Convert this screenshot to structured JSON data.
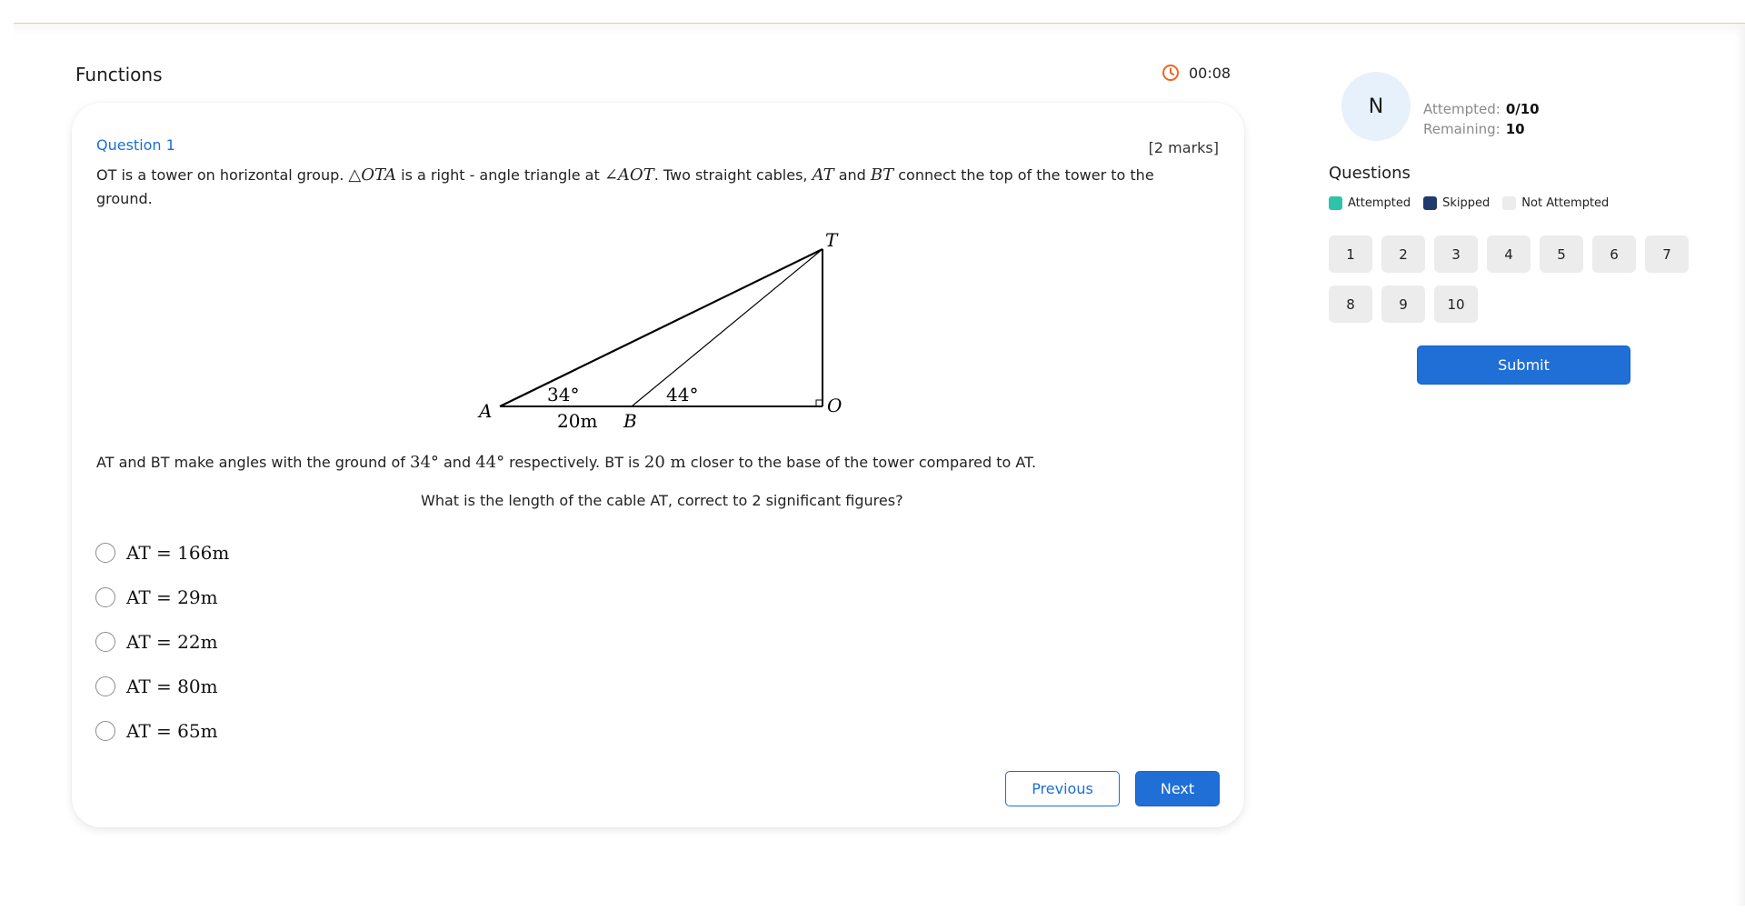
{
  "quiz": {
    "title": "Functions",
    "timer": "00:08"
  },
  "question": {
    "number_label": "Question 1",
    "marks": "[2 marks]",
    "stem": {
      "p1": "OT is a tower on horizontal group. ",
      "m1": "△OTA",
      "p2": " is a right - angle triangle at ",
      "m2": "∠AOT",
      "p3": ". Two straight cables, ",
      "m3": "AT",
      "p4": " and ",
      "m4": "BT",
      "p5": " connect the top of the tower to the ground."
    },
    "diagram": {
      "labels": {
        "A": "A",
        "B": "B",
        "T": "T",
        "O": "O",
        "angle_A": "34°",
        "angle_B": "44°",
        "distance_AB": "20m"
      }
    },
    "info": {
      "p1": "AT and BT make angles with the ground of ",
      "m1": "34°",
      "p2": " and ",
      "m2": "44°",
      "p3": " respectively. BT is ",
      "m3": "20 m",
      "p4": " closer to the base of the tower compared to AT."
    },
    "prompt": "What is the length of the cable AT, correct to 2 significant figures?",
    "options": [
      "AT = 166m",
      "AT = 29m",
      "AT = 22m",
      "AT = 80m",
      "AT = 65m"
    ]
  },
  "nav": {
    "previous_label": "Previous",
    "next_label": "Next"
  },
  "sidebar": {
    "avatar_initial": "N",
    "attempted_label": "Attempted:",
    "attempted_value": "0/10",
    "remaining_label": "Remaining:",
    "remaining_value": "10",
    "questions_title": "Questions",
    "legend": [
      {
        "label": "Attempted",
        "color": "#2ec4a9"
      },
      {
        "label": "Skipped",
        "color": "#1f3a6e"
      },
      {
        "label": "Not Attempted",
        "color": "#ececec"
      }
    ],
    "question_numbers": [
      "1",
      "2",
      "3",
      "4",
      "5",
      "6",
      "7",
      "8",
      "9",
      "10"
    ],
    "submit_label": "Submit"
  },
  "colors": {
    "accent": "#1f6fd6",
    "timer_icon": "#f26522"
  }
}
